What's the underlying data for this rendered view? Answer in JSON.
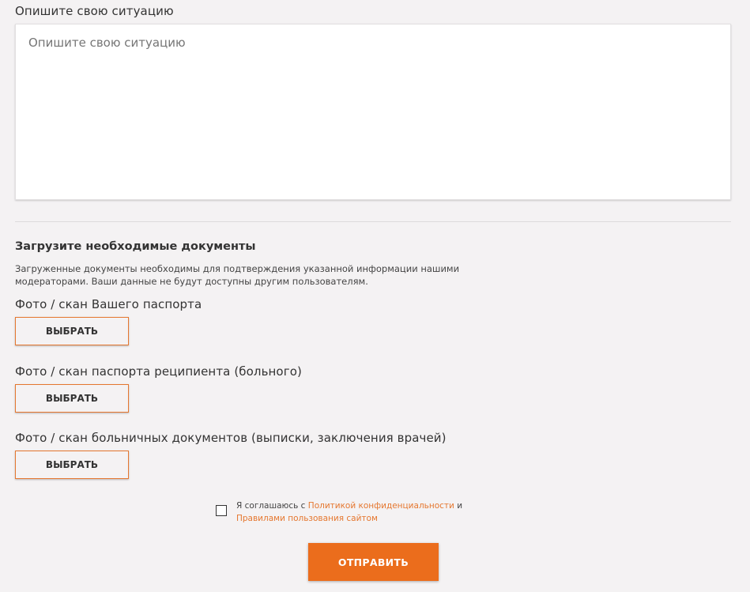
{
  "situation": {
    "label": "Опишите свою ситуацию",
    "placeholder": "Опишите свою ситуацию",
    "value": ""
  },
  "documents": {
    "title": "Загрузите необходимые документы",
    "description": "Загруженные документы необходимы для подтверждения указанной информации нашими модераторами. Ваши данные не будут доступны другим пользователям.",
    "items": [
      {
        "label": "Фото / скан Вашего паспорта",
        "button_label": "ВЫБРАТЬ"
      },
      {
        "label": "Фото / скан паспорта реципиента (больного)",
        "button_label": "ВЫБРАТЬ"
      },
      {
        "label": "Фото / скан больничных документов (выписки, заключения врачей)",
        "button_label": "ВЫБРАТЬ"
      }
    ]
  },
  "consent": {
    "checked": false,
    "prefix": "Я соглашаюсь с ",
    "privacy_link": "Политикой конфиденциальности",
    "conjunction": " и ",
    "terms_link": "Правилами пользования сайтом"
  },
  "submit": {
    "label": "ОТПРАВИТЬ"
  },
  "colors": {
    "accent": "#eb6d1c",
    "link": "#e5772f",
    "background": "#f4f2f3",
    "text": "#333333"
  }
}
